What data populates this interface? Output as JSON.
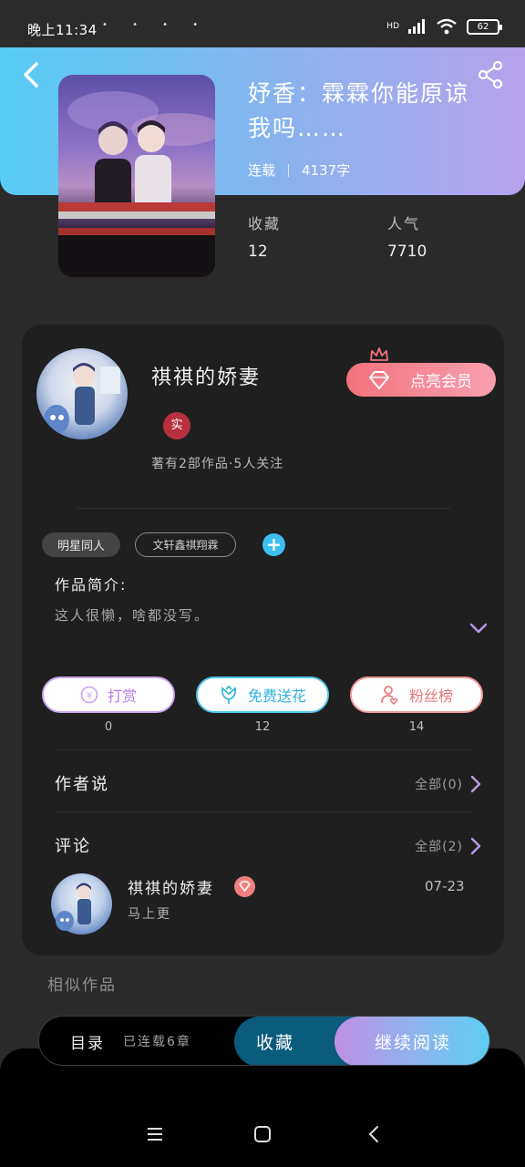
{
  "status_bar": {
    "time": "晚上11:34",
    "battery": "62",
    "network": "HD"
  },
  "book": {
    "title": "妤香：霖霖你能原谅我吗……",
    "status": "连载",
    "word_count": "4137字",
    "favorites_label": "收藏",
    "favorites": "12",
    "popularity_label": "人气",
    "popularity": "7710"
  },
  "author": {
    "name": "祺祺的娇妻",
    "verified": "实",
    "stats": "著有2部作品·5人关注",
    "vip_button": "点亮会员"
  },
  "tags": [
    "明星同人",
    "文轩鑫祺翔霖"
  ],
  "intro": {
    "label": "作品简介:",
    "text": "这人很懒，啥都没写。"
  },
  "actions": [
    {
      "label": "打赏",
      "count": "0",
      "icon": "coin-icon"
    },
    {
      "label": "免费送花",
      "count": "12",
      "icon": "flower-icon"
    },
    {
      "label": "粉丝榜",
      "count": "14",
      "icon": "user-heart-icon"
    }
  ],
  "author_says": {
    "label": "作者说",
    "more": "全部(0)"
  },
  "comments": {
    "label": "评论",
    "more": "全部(2)",
    "items": [
      {
        "user": "祺祺的娇妻",
        "date": "07-23",
        "text": "马上更"
      }
    ]
  },
  "similar": {
    "label": "相似作品"
  },
  "bottom_bar": {
    "toc_label": "目录",
    "chapter_count": "已连载6章",
    "collect_label": "收藏",
    "read_label": "继续阅读"
  },
  "colors": {
    "accent_blue": "#55ccf3",
    "accent_purple": "#b7a2ec",
    "vip_pink": "#f3727c",
    "card_bg": "#1f1f20"
  }
}
